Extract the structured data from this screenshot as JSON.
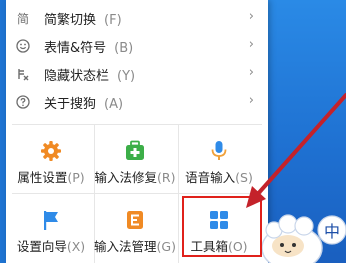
{
  "menu_items": [
    {
      "label": "简繁切换",
      "key": "(F)",
      "icon": "simplified-traditional-icon"
    },
    {
      "label": "表情&符号",
      "key": "(B)",
      "icon": "emoji-icon"
    },
    {
      "label": "隐藏状态栏",
      "key": "(Y)",
      "icon": "hide-statusbar-icon"
    },
    {
      "label": "关于搜狗",
      "key": "(A)",
      "icon": "help-icon"
    }
  ],
  "menu_first_icon_glyph": "简",
  "menu_chevron_glyph": "›",
  "grid": [
    {
      "label": "属性设置",
      "key": "(P)",
      "icon": "settings-gear-icon",
      "color": "#f08a24"
    },
    {
      "label": "输入法修复",
      "key": "(R)",
      "icon": "repair-kit-icon",
      "color": "#3cae48"
    },
    {
      "label": "语音输入",
      "key": "(S)",
      "icon": "microphone-icon",
      "color": "#2f8be8"
    },
    {
      "label": "设置向导",
      "key": "(X)",
      "icon": "flag-icon",
      "color": "#2f8be8"
    },
    {
      "label": "输入法管理",
      "key": "(G)",
      "icon": "manager-icon",
      "color": "#f08a24"
    },
    {
      "label": "工具箱",
      "key": "(O)",
      "icon": "toolbox-grid-icon",
      "color": "#2f8be8"
    }
  ],
  "colors": {
    "desktop": "#1f74d2",
    "highlight_box": "#e0211b",
    "arrow": "#c4222a"
  },
  "cartoon_char": "中"
}
